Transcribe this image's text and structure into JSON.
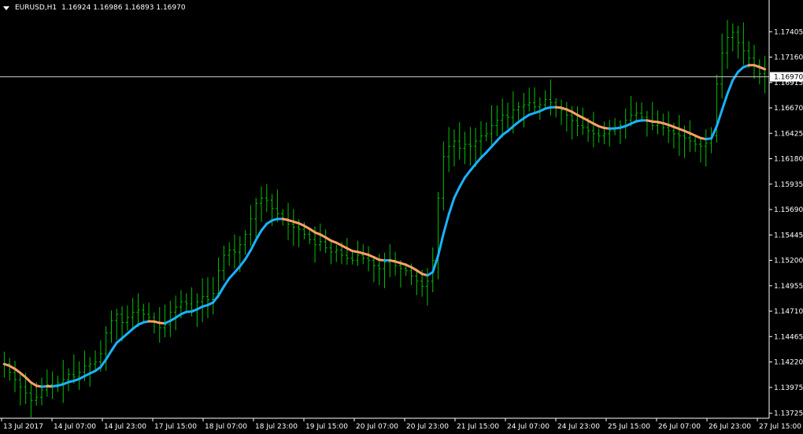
{
  "header": {
    "symbol": "EURUSD,H1",
    "ohlc": "1.16924 1.16986 1.16893 1.16970"
  },
  "chart_data": {
    "type": "candlestick",
    "symbol": "EURUSD",
    "timeframe": "H1",
    "current_price": "1.16970",
    "y_ticks": [
      "1.17405",
      "1.17160",
      "1.16915",
      "1.16670",
      "1.16425",
      "1.16180",
      "1.15935",
      "1.15690",
      "1.15445",
      "1.15200",
      "1.14955",
      "1.14710",
      "1.14465",
      "1.14220",
      "1.13975",
      "1.13725"
    ],
    "x_ticks": [
      "13 Jul 2017",
      "14 Jul 07:00",
      "14 Jul 23:00",
      "17 Jul 15:00",
      "18 Jul 07:00",
      "18 Jul 23:00",
      "19 Jul 15:00",
      "20 Jul 07:00",
      "20 Jul 23:00",
      "21 Jul 15:00",
      "24 Jul 07:00",
      "24 Jul 23:00",
      "25 Jul 15:00",
      "26 Jul 07:00",
      "26 Jul 23:00",
      "27 Jul 15:00"
    ],
    "ylim": [
      1.137,
      1.1765
    ],
    "bar_color": "#00c000",
    "ma_colors": {
      "rising": "#1ab2ff",
      "falling": "#ffa066"
    },
    "closes": [
      1.142,
      1.1412,
      1.1405,
      1.1398,
      1.1392,
      1.1385,
      1.1388,
      1.1395,
      1.14,
      1.1398,
      1.1402,
      1.1405,
      1.141,
      1.1408,
      1.1412,
      1.1418,
      1.142,
      1.1422,
      1.143,
      1.145,
      1.1462,
      1.1468,
      1.146,
      1.1465,
      1.147,
      1.1472,
      1.1468,
      1.1465,
      1.146,
      1.1455,
      1.1458,
      1.147,
      1.1475,
      1.148,
      1.1478,
      1.1472,
      1.148,
      1.1485,
      1.1482,
      1.1488,
      1.151,
      1.1525,
      1.153,
      1.1528,
      1.1535,
      1.1545,
      1.156,
      1.1575,
      1.158,
      1.1578,
      1.157,
      1.1565,
      1.156,
      1.1555,
      1.1552,
      1.155,
      1.1545,
      1.154,
      1.1535,
      1.1538,
      1.1532,
      1.1528,
      1.153,
      1.1525,
      1.1522,
      1.152,
      1.1525,
      1.1522,
      1.152,
      1.1515,
      1.1512,
      1.1518,
      1.152,
      1.1515,
      1.1512,
      1.151,
      1.1505,
      1.15,
      1.1495,
      1.15,
      1.152,
      1.158,
      1.162,
      1.163,
      1.1635,
      1.1628,
      1.1632,
      1.163,
      1.1635,
      1.164,
      1.1642,
      1.165,
      1.1655,
      1.166,
      1.1658,
      1.1665,
      1.1668,
      1.167,
      1.1672,
      1.1668,
      1.167,
      1.1675,
      1.1672,
      1.1668,
      1.1665,
      1.166,
      1.1655,
      1.165,
      1.1648,
      1.1645,
      1.1642,
      1.164,
      1.1642,
      1.1645,
      1.1648,
      1.165,
      1.1655,
      1.166,
      1.1662,
      1.1658,
      1.1655,
      1.165,
      1.1652,
      1.1648,
      1.1645,
      1.1642,
      1.164,
      1.1638,
      1.1635,
      1.1632,
      1.163,
      1.1633,
      1.164,
      1.169,
      1.172,
      1.1735,
      1.174,
      1.173,
      1.1722,
      1.1715,
      1.1708,
      1.17,
      1.1697
    ]
  }
}
